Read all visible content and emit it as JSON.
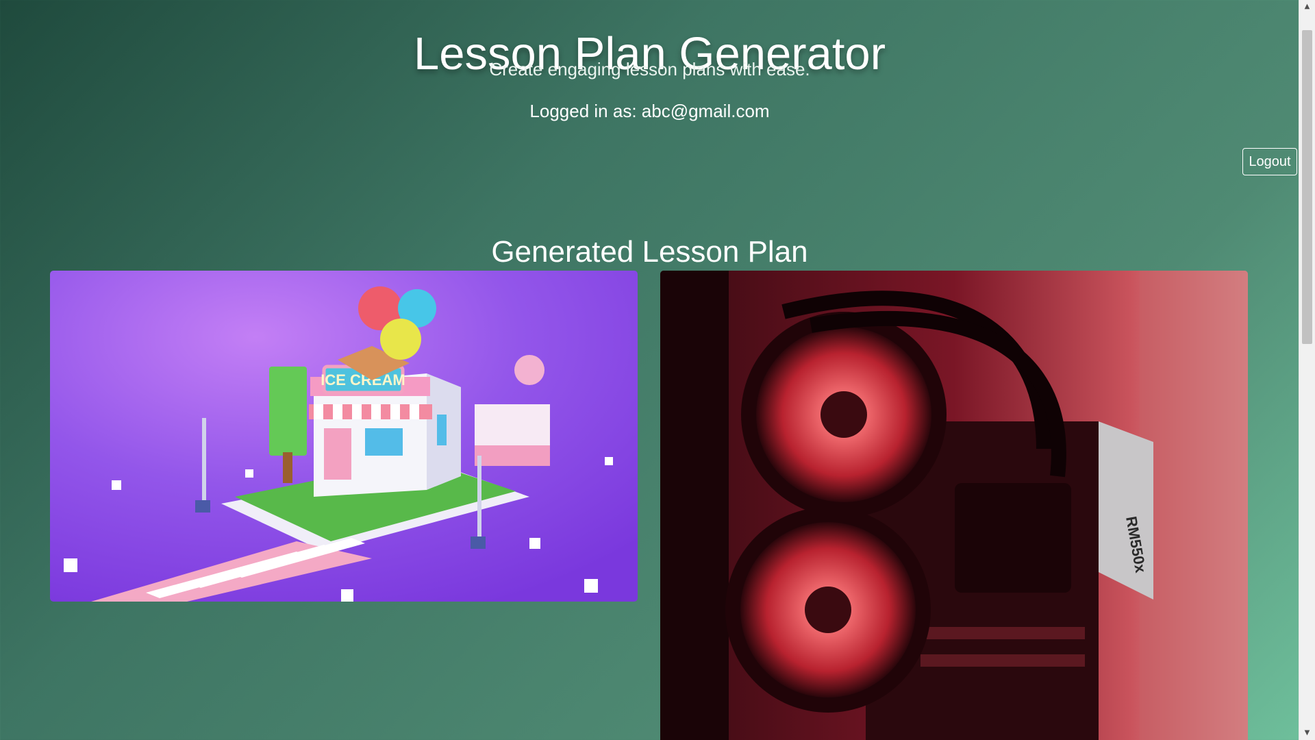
{
  "header": {
    "title": "Lesson Plan Generator",
    "subtitle": "Create engaging lesson plans with ease.",
    "logged_in_text": "Logged in as: abc@gmail.com",
    "logout_label": "Logout"
  },
  "main": {
    "section_title": "Generated Lesson Plan",
    "images": [
      {
        "description_icon": "ice-cream-shop-illustration",
        "sign_text": "ICE CREAM"
      },
      {
        "description_icon": "pc-hardware-photo"
      }
    ]
  },
  "scrollbar": {
    "up_icon": "▲",
    "down_icon": "▼"
  },
  "colors": {
    "gradient_start": "#1f4a3d",
    "gradient_end": "#6fc09c",
    "ice_cream_bg": "#8a4ee8",
    "pc_red": "#c8283a"
  }
}
